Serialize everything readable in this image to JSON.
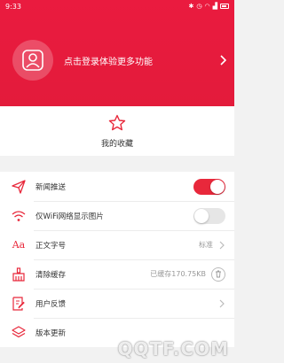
{
  "status_bar": {
    "time": "9:33"
  },
  "profile": {
    "login_prompt": "点击登录体验更多功能"
  },
  "favorites": {
    "label": "我的收藏"
  },
  "settings": [
    {
      "key": "news_push",
      "label": "新闻推送",
      "icon": "send-icon",
      "control": "toggle",
      "state": "on"
    },
    {
      "key": "wifi_images",
      "label": "仅WiFi网络显示图片",
      "icon": "wifi-icon",
      "control": "toggle",
      "state": "off"
    },
    {
      "key": "font_size",
      "label": "正文字号",
      "icon": "font-size-icon",
      "value": "标准"
    },
    {
      "key": "clear_cache",
      "label": "清除缓存",
      "icon": "broom-icon",
      "value": "已缓存170.75KB"
    },
    {
      "key": "feedback",
      "label": "用户反馈",
      "icon": "feedback-icon"
    },
    {
      "key": "version",
      "label": "版本更新",
      "icon": "layers-icon"
    }
  ],
  "watermark": {
    "text": "QQTF.COM"
  },
  "colors": {
    "brand_red": "#e31b3b",
    "toggle_on": "#e8283b"
  }
}
